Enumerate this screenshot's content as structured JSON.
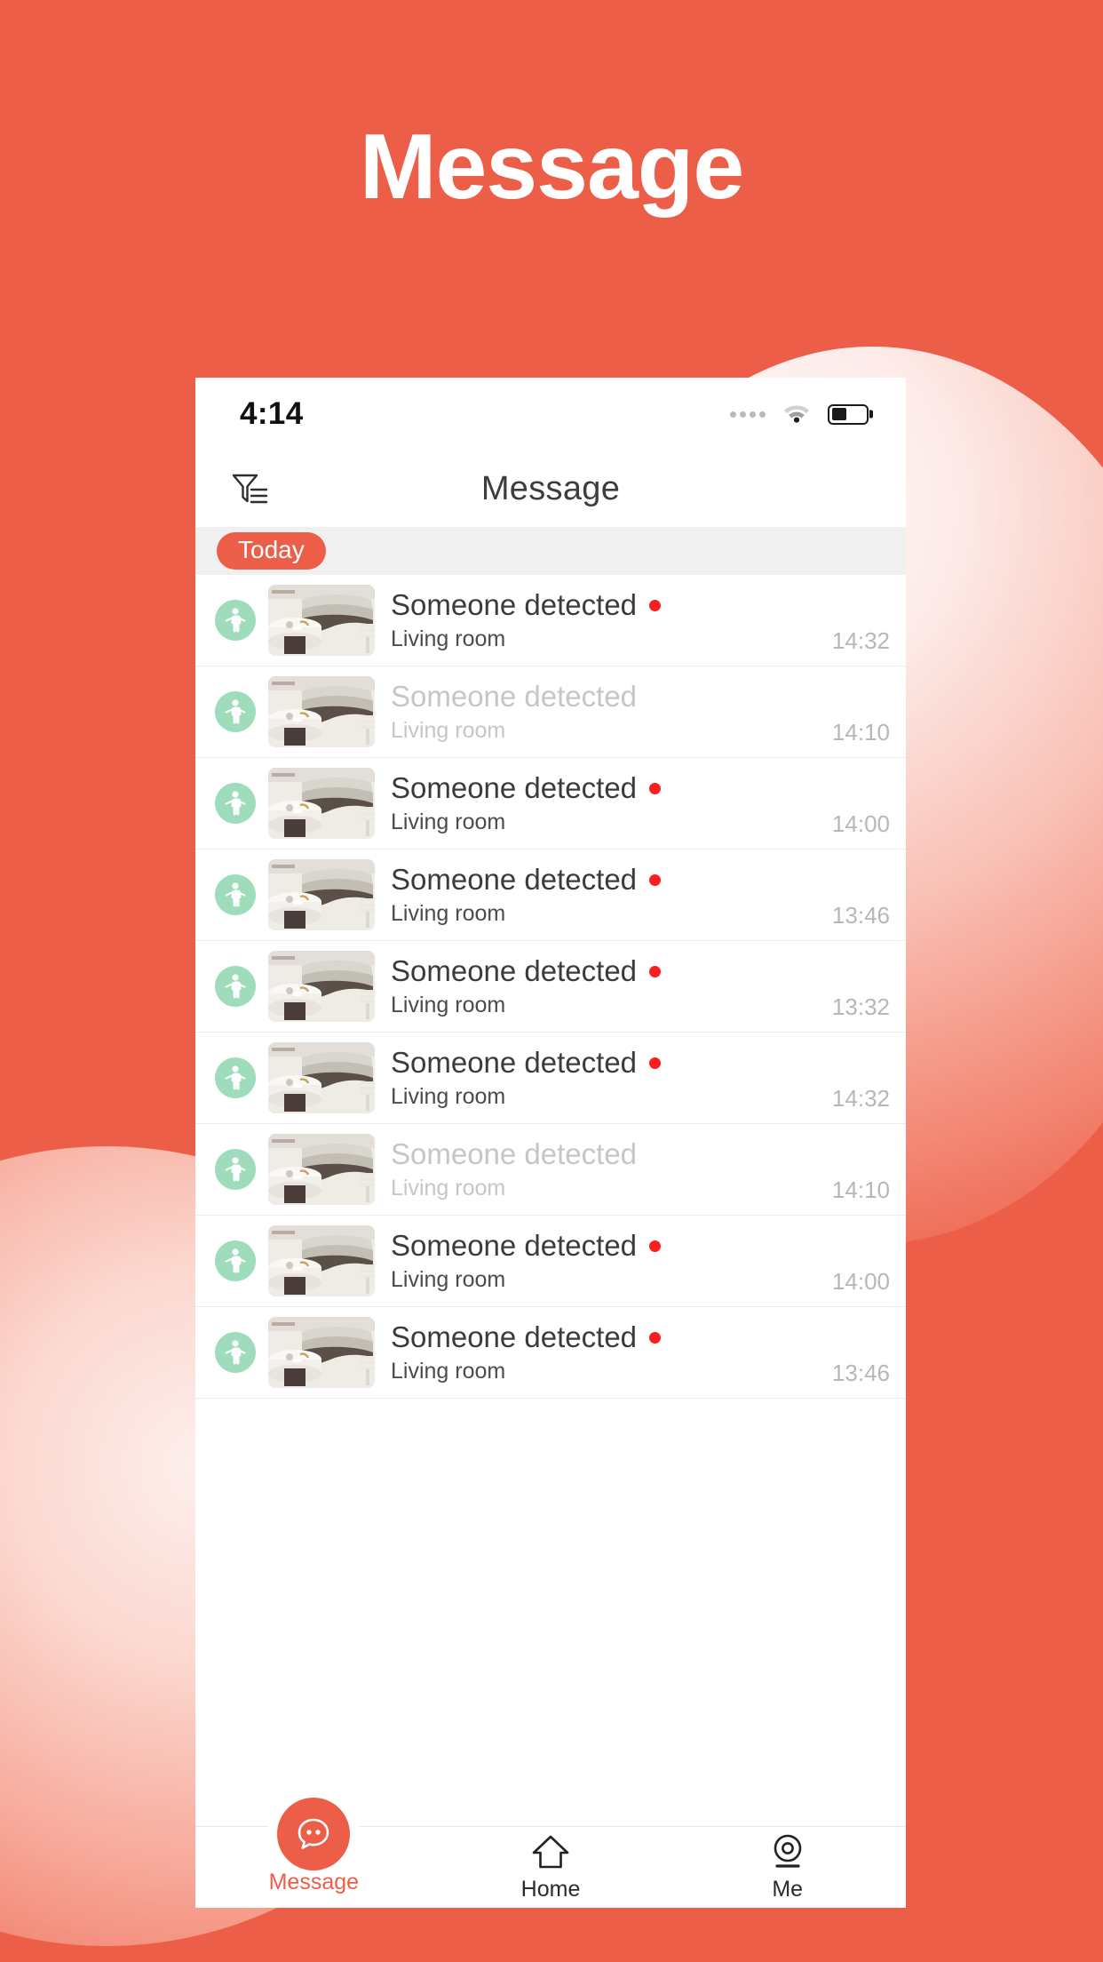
{
  "theme": {
    "brand_color": "#ec5e47",
    "badge_green": "#9fdcbb",
    "unread_red": "#fa1e1e",
    "muted_text": "#c6c6c6",
    "time_text": "#b7b7b7"
  },
  "page": {
    "heading": "Message"
  },
  "status_bar": {
    "time": "4:14",
    "signal_icon": "signal-dots-icon",
    "wifi_icon": "wifi-icon",
    "battery_icon": "battery-icon",
    "battery_level_percent": 45
  },
  "nav_bar": {
    "title": "Message",
    "filter_icon": "filter-funnel-icon"
  },
  "list_header": {
    "date_label": "Today"
  },
  "messages": [
    {
      "type_icon": "person-detected-icon",
      "thumbnail": "living-room-sofa-thumbnail",
      "title": "Someone detected",
      "location": "Living room",
      "time": "14:32",
      "unread": true
    },
    {
      "type_icon": "person-detected-icon",
      "thumbnail": "living-room-sofa-thumbnail",
      "title": "Someone detected",
      "location": "Living room",
      "time": "14:10",
      "unread": false
    },
    {
      "type_icon": "person-detected-icon",
      "thumbnail": "living-room-sofa-thumbnail",
      "title": "Someone detected",
      "location": "Living room",
      "time": "14:00",
      "unread": true
    },
    {
      "type_icon": "person-detected-icon",
      "thumbnail": "living-room-sofa-thumbnail",
      "title": "Someone detected",
      "location": "Living room",
      "time": "13:46",
      "unread": true
    },
    {
      "type_icon": "person-detected-icon",
      "thumbnail": "living-room-sofa-thumbnail",
      "title": "Someone detected",
      "location": "Living room",
      "time": "13:32",
      "unread": true
    },
    {
      "type_icon": "person-detected-icon",
      "thumbnail": "living-room-sofa-thumbnail",
      "title": "Someone detected",
      "location": "Living room",
      "time": "14:32",
      "unread": true
    },
    {
      "type_icon": "person-detected-icon",
      "thumbnail": "living-room-sofa-thumbnail",
      "title": "Someone detected",
      "location": "Living room",
      "time": "14:10",
      "unread": false
    },
    {
      "type_icon": "person-detected-icon",
      "thumbnail": "living-room-sofa-thumbnail",
      "title": "Someone detected",
      "location": "Living room",
      "time": "14:00",
      "unread": true
    },
    {
      "type_icon": "person-detected-icon",
      "thumbnail": "living-room-sofa-thumbnail",
      "title": "Someone detected",
      "location": "Living room",
      "time": "13:46",
      "unread": true
    }
  ],
  "tab_bar": {
    "tabs": [
      {
        "label": "Message",
        "icon": "chat-bubble-icon",
        "active": true
      },
      {
        "label": "Home",
        "icon": "house-icon",
        "active": false
      },
      {
        "label": "Me",
        "icon": "camera-lens-icon",
        "active": false
      }
    ]
  }
}
